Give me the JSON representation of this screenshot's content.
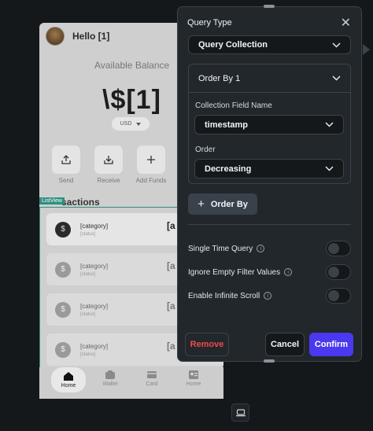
{
  "preview": {
    "greeting": "Hello [1]",
    "balance_label": "Available Balance",
    "balance_value": "\\$[1]",
    "currency": "USD",
    "actions": [
      {
        "label": "Send",
        "icon": "upload-icon"
      },
      {
        "label": "Receive",
        "icon": "download-icon"
      },
      {
        "label": "Add Funds",
        "icon": "plus-icon"
      }
    ],
    "section_title": "sactions",
    "listview_tag": "ListView",
    "transactions": [
      {
        "category": "[category]",
        "status": "[status]",
        "amount": "[a",
        "icon": "$"
      },
      {
        "category": "[category]",
        "status": "[status]",
        "amount": "[a",
        "icon": "$"
      },
      {
        "category": "[category]",
        "status": "[status]",
        "amount": "[a",
        "icon": "$"
      },
      {
        "category": "[category]",
        "status": "[status]",
        "amount": "[a",
        "icon": "$"
      }
    ],
    "nav": [
      {
        "label": "Home",
        "icon": "home-icon",
        "active": true
      },
      {
        "label": "Wallet",
        "icon": "wallet-icon",
        "active": false
      },
      {
        "label": "Card",
        "icon": "card-icon",
        "active": false
      },
      {
        "label": "Home",
        "icon": "profile-card-icon",
        "active": false
      }
    ]
  },
  "panel": {
    "title": "Query Type",
    "close": "✕",
    "query_type_value": "Query Collection",
    "order_by_header": "Order By 1",
    "field_name_label": "Collection Field Name",
    "field_name_value": "timestamp",
    "order_label": "Order",
    "order_value": "Decreasing",
    "add_order_by": "Order By",
    "add_icon": "+",
    "toggles": [
      {
        "label": "Single Time Query",
        "on": false
      },
      {
        "label": "Ignore Empty Filter Values",
        "on": false
      },
      {
        "label": "Enable Infinite Scroll",
        "on": false
      }
    ],
    "info_icon": "i",
    "remove_label": "Remove",
    "cancel_label": "Cancel",
    "confirm_label": "Confirm"
  },
  "colors": {
    "panel_bg": "#22272b",
    "accent": "#4b39ef",
    "danger": "#ef4a4a",
    "listview_border": "#2e8f7e"
  }
}
